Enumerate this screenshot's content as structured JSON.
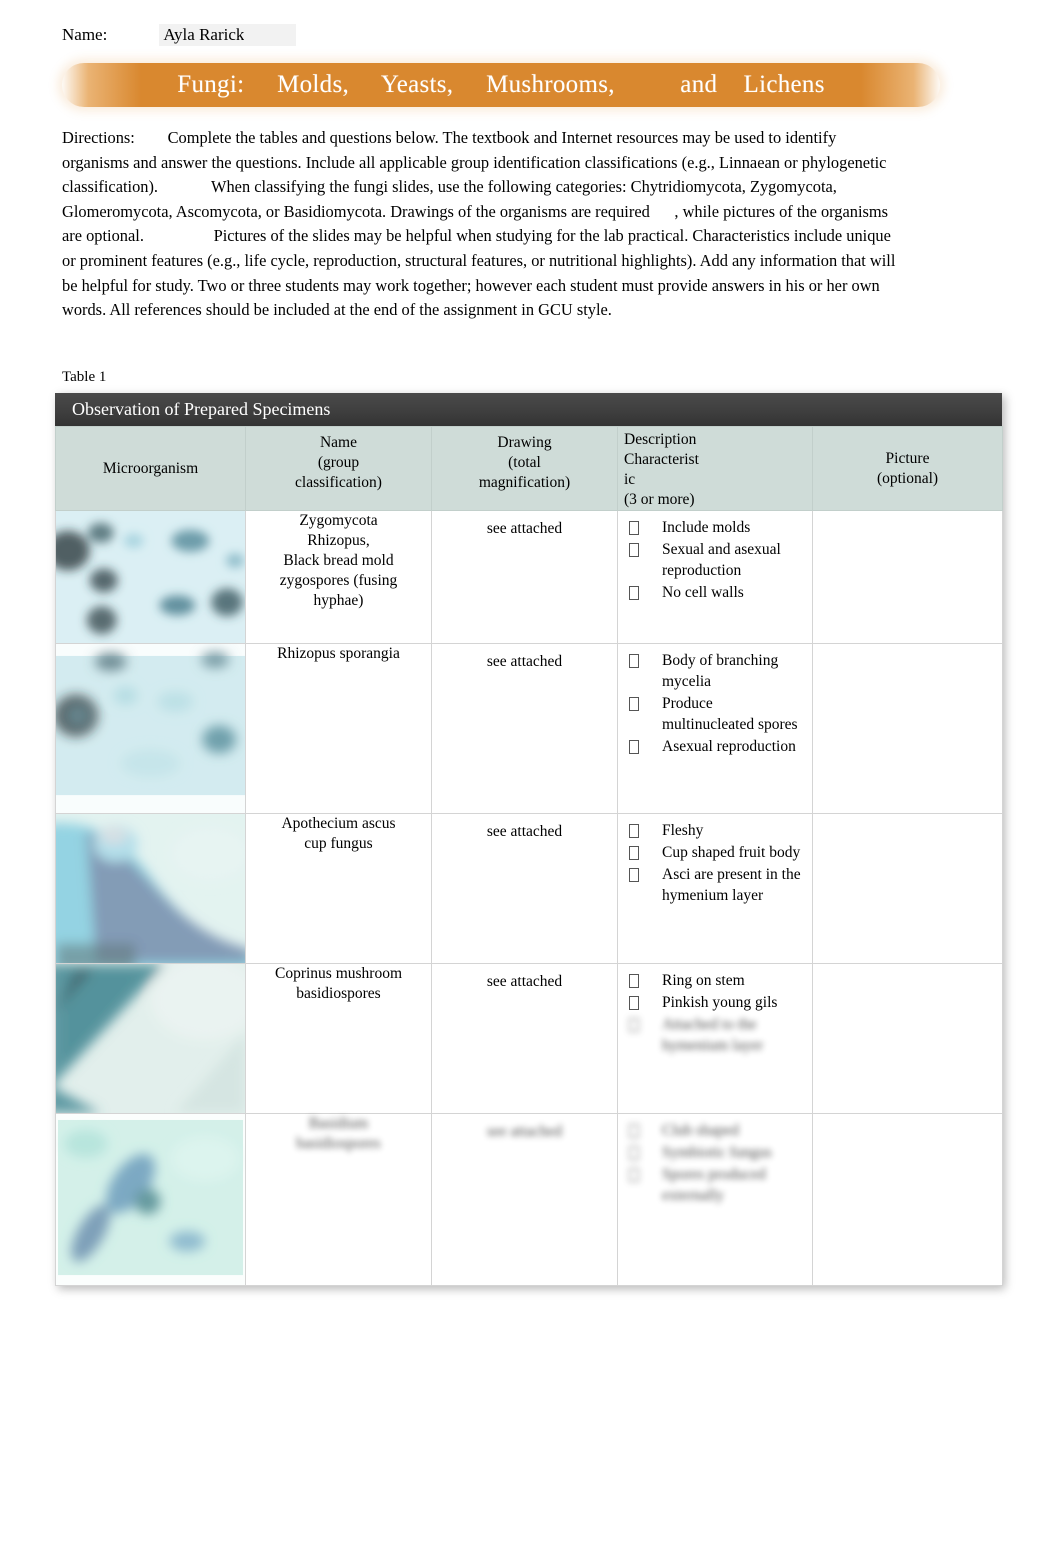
{
  "header": {
    "name_label": "Name:",
    "name_value": "Ayla Rarick",
    "title": "Fungi:     Molds,     Yeasts,     Mushrooms,          and    Lichens"
  },
  "directions": {
    "text": "Directions:        Complete the tables and questions below. The textbook and Internet resources may be used to identify organisms and answer the questions. Include all applicable group identification classifications (e.g., Linnaean or phylogenetic classification).             When classifying the fungi slides, use the following categories: Chytridiomycota, Zygomycota, Glomeromycota, Ascomycota, or Basidiomycota. Drawings of the organisms are required      , while pictures of the organisms are optional.                 Pictures of the slides may be helpful when studying for the lab practical. Characteristics include unique or prominent features (e.g., life cycle, reproduction, structural features, or nutritional highlights). Add any information that will be helpful for study. Two or three students may work together; however each student must provide answers in his or her own words. All references should be included at the end of the assignment in GCU style."
  },
  "table": {
    "caption": "Table 1",
    "title": "Observation of Prepared Specimens",
    "columns": [
      {
        "label": "Microorganism",
        "align": "center"
      },
      {
        "label": "Name\n(group\nclassification)",
        "align": "center"
      },
      {
        "label": "Drawing\n(total\nmagnification)",
        "align": "center"
      },
      {
        "label": "Description\nCharacterist\nic\n(3 or more)",
        "align": "left"
      },
      {
        "label": "Picture\n(optional)",
        "align": "center"
      }
    ],
    "rows": [
      {
        "image": "micrograph-zygospores",
        "name": "Zygomycota\nRhizopus,\nBlack bread mold\nzygospores      (fusing\nhyphae)",
        "drawing": "see attached",
        "characteristics": [
          "Include molds",
          "Sexual and asexual reproduction",
          "No cell walls"
        ],
        "picture": "",
        "blurred": false
      },
      {
        "image": "micrograph-sporangia",
        "name": "Rhizopus     sporangia",
        "drawing": "see attached",
        "characteristics": [
          "Body of branching mycelia",
          "Produce multinucleated spores",
          "Asexual reproduction"
        ],
        "picture": "",
        "blurred": false
      },
      {
        "image": "micrograph-apothecium",
        "name": "Apothecium      ascus\ncup fungus",
        "drawing": "see attached",
        "characteristics": [
          "Fleshy",
          "Cup shaped fruit body",
          "Asci are present in the hymenium layer"
        ],
        "picture": "",
        "blurred": false
      },
      {
        "image": "micrograph-coprinus-gills",
        "name": "Coprinus    mushroom\nbasidiospores",
        "drawing": "see attached",
        "characteristics": [
          "Ring on stem",
          "Pinkish young gils",
          "Attached to the hymenium layer"
        ],
        "picture": "",
        "blurred": false,
        "blurred_tail": true
      },
      {
        "image": "micrograph-lichen",
        "name": "Basidium\nbasidiospores",
        "drawing": "see attached",
        "characteristics": [
          "Club shaped",
          "Symbiotic fungus",
          "Spores produced externally"
        ],
        "picture": "",
        "blurred": true
      }
    ]
  },
  "colors": {
    "banner": "#d9882f",
    "table_title_bar": "#3f3f3f",
    "column_header": "#cfdcd8",
    "grid_line": "#d4d4d4"
  }
}
